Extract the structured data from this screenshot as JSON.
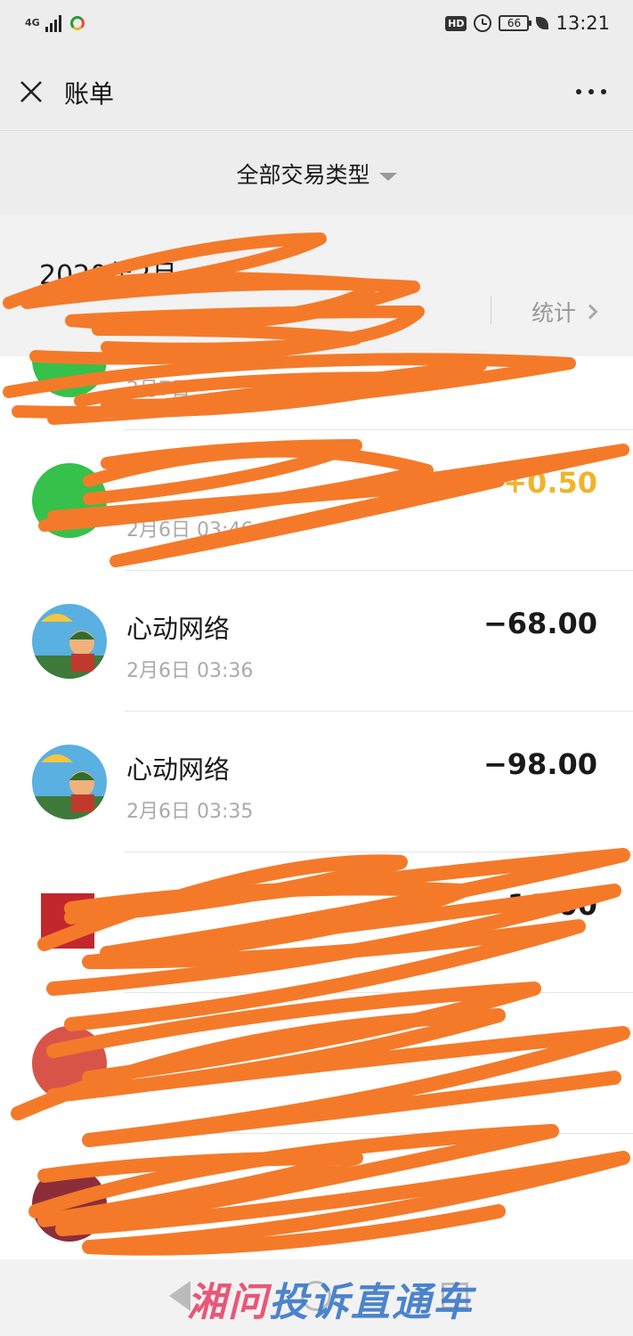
{
  "status_bar": {
    "network": "4G",
    "hd": "HD",
    "battery": "66",
    "time": "13:21"
  },
  "header": {
    "title": "账单"
  },
  "filter": {
    "label": "全部交易类型"
  },
  "month": {
    "label": "2020年2月",
    "stats_label": "统计"
  },
  "transactions": [
    {
      "name": "",
      "time": "2月7日",
      "amount": "",
      "avatar": "wechat-pay-icon"
    },
    {
      "name": "",
      "time": "2月6日 03:46",
      "amount": "+0.50",
      "avatar": "wechat-pay-icon"
    },
    {
      "name": "心动网络",
      "time": "2月6日 03:36",
      "amount": "−68.00",
      "avatar": "game-avatar"
    },
    {
      "name": "心动网络",
      "time": "2月6日 03:35",
      "amount": "−98.00",
      "avatar": "game-avatar"
    },
    {
      "name": "",
      "time": "",
      "amount": "−10.00",
      "avatar": "miniso-logo"
    },
    {
      "name": "",
      "time": "",
      "amount": "",
      "avatar": "red-avatar"
    },
    {
      "name": "",
      "time": "",
      "amount": "",
      "avatar": "photo-avatar"
    }
  ],
  "watermark": {
    "part1": "湘问",
    "part2": "投诉直通车"
  },
  "colors": {
    "income": "#f1b32a",
    "scribble": "#f47a2a",
    "wechat_green": "#35c14a"
  }
}
